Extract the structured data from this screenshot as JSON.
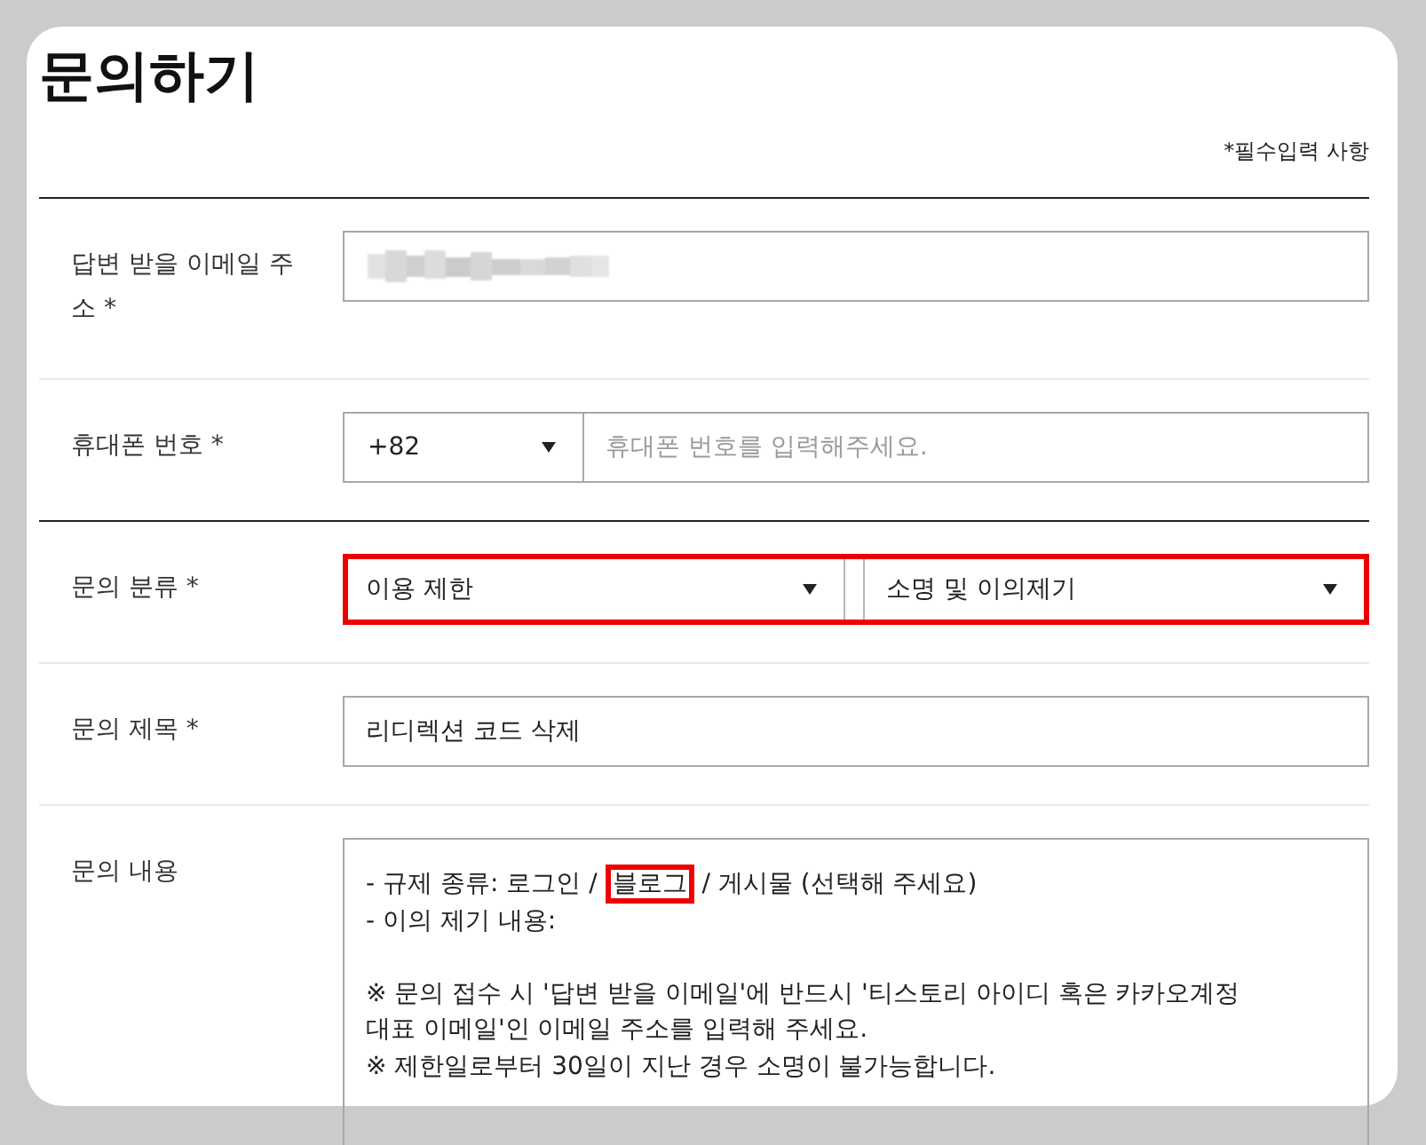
{
  "title": "문의하기",
  "required_note": "*필수입력 사항",
  "sections": [
    {
      "rows": [
        {
          "kind": "email",
          "label": "답변 받을 이메일 주소 *",
          "value_blurred": true
        },
        {
          "kind": "phone",
          "label": "휴대폰 번호 *",
          "country_code": "+82",
          "placeholder": "휴대폰 번호를 입력해주세요."
        }
      ]
    },
    {
      "rows": [
        {
          "kind": "category",
          "label": "문의 분류 *",
          "highlighted": true,
          "selects": [
            "이용 제한",
            "소명 및 이의제기"
          ]
        },
        {
          "kind": "text",
          "label": "문의 제목 *",
          "value": "리디렉션 코드 삭제"
        },
        {
          "kind": "textarea",
          "label": "문의 내용",
          "paragraphs": [
            {
              "lines": [
                {
                  "parts": [
                    {
                      "text": "- 규제 종류: 로그인 /",
                      "highlighted": false
                    },
                    {
                      "text": "블로그",
                      "highlighted": true
                    },
                    {
                      "text": "/ 게시물 (선택해 주세요)",
                      "highlighted": false
                    }
                  ]
                },
                {
                  "parts": [
                    {
                      "text": "- 이의 제기 내용:",
                      "highlighted": false
                    }
                  ]
                }
              ]
            },
            {
              "lines": [
                {
                  "parts": [
                    {
                      "text": "※ 문의 접수 시 '답변 받을 이메일'에 반드시 '티스토리 아이디 혹은 카카오계정 대표 이메일'인 이메일 주소를 입력해 주세요.",
                      "highlighted": false
                    }
                  ]
                },
                {
                  "parts": [
                    {
                      "text": "※ 제한일로부터 30일이 지난 경우 소명이 불가능합니다.",
                      "highlighted": false
                    }
                  ]
                }
              ]
            }
          ]
        }
      ]
    }
  ]
}
